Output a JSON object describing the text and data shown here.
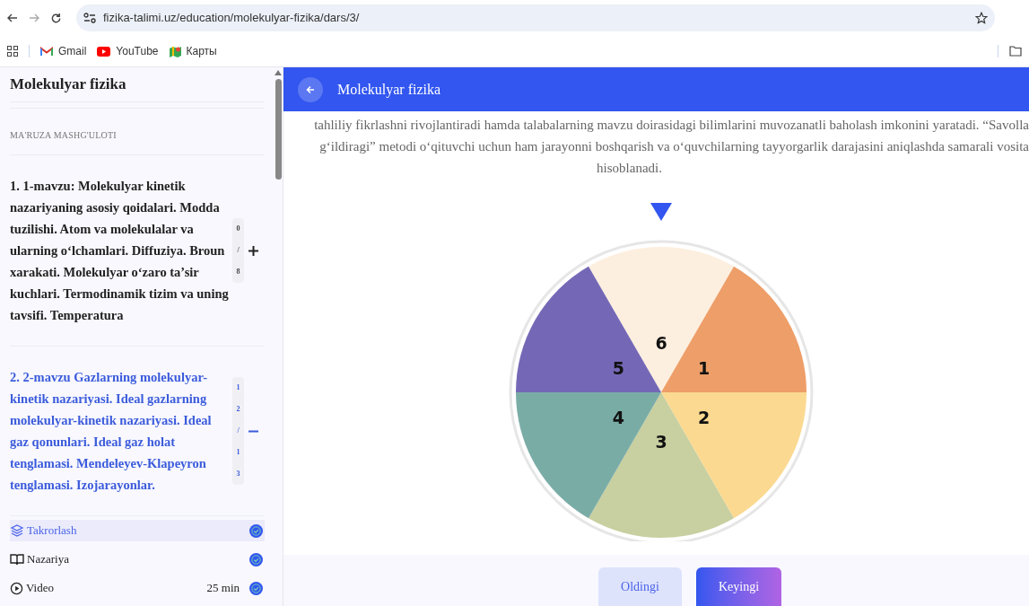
{
  "browser": {
    "url": "fizika-talimi.uz/education/molekulyar-fizika/dars/3/",
    "bookmarks": [
      {
        "kind": "gmail",
        "label": "Gmail"
      },
      {
        "kind": "youtube",
        "label": "YouTube"
      },
      {
        "kind": "maps",
        "label": "Карты"
      }
    ]
  },
  "sidebar": {
    "title": "Molekulyar fizika",
    "section": "MA'RUZA MASHG'ULOTI",
    "topics": [
      {
        "title": "1. 1-mavzu: Molekulyar kinetik nazariyaning asosiy qoidalari. Modda tuzilishi. Atom va molekulalar va ularning o‘lchamlari. Diffuziya. Broun xarakati. Molekulyar o‘zaro ta’sir kuchlari. Termodinamik tizim va uning tavsifi. Temperatura",
        "counter": [
          "0",
          "/",
          "8"
        ],
        "expanded": false
      },
      {
        "title": "2. 2-mavzu Gazlarning molekulyar-kinetik nazariyasi. Ideal gazlarning molekulyar-kinetik nazariyasi. Ideal gaz qonunlari. Ideal gaz holat tenglamasi. Mendeleyev-Klapeyron tenglamasi. Izojarayonlar.",
        "counter": [
          "1",
          "2",
          "/",
          "1",
          "3"
        ],
        "expanded": true,
        "lessons": [
          {
            "kind": "layers",
            "label": "Takrorlash",
            "selected": true,
            "done": true
          },
          {
            "kind": "book",
            "label": "Nazariya",
            "selected": false,
            "done": true
          },
          {
            "kind": "video",
            "label": "Video",
            "duration": "25 min",
            "selected": false,
            "done": true
          }
        ]
      }
    ]
  },
  "header": {
    "title": "Molekulyar fizika"
  },
  "paragraph_lines": [
    "tahliliy fikrlashni rivojlantiradi hamda talabalarning mavzu doirasidagi bilimlarini muvozanatli baholash imkonini yaratadi. “Savolla",
    "g‘ildiragi” metodi o‘qituvchi uchun ham jarayonni boshqarish va o‘quvchilarning tayyorgarlik darajasini aniqlashda samarali vosita",
    "hisoblanadi."
  ],
  "wheel": {
    "segments": [
      {
        "label": "6",
        "color": "#fdefdf"
      },
      {
        "label": "1",
        "color": "#ee9e68"
      },
      {
        "label": "2",
        "color": "#fbd991"
      },
      {
        "label": "3",
        "color": "#c8cfa0"
      },
      {
        "label": "4",
        "color": "#7aaca6"
      },
      {
        "label": "5",
        "color": "#7468b6"
      }
    ]
  },
  "buttons": {
    "previous": "Oldingi",
    "next": "Keyingi"
  }
}
